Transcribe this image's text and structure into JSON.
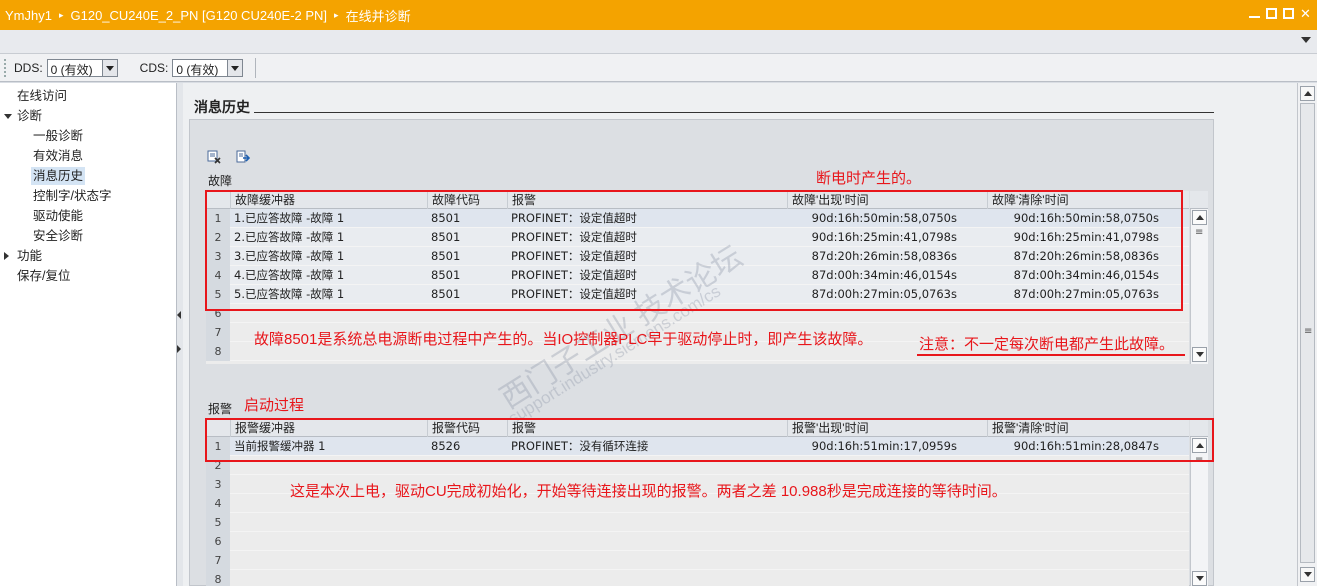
{
  "titlebar": {
    "crumbs": [
      "YmJhy1",
      "G120_CU240E_2_PN [G120 CU240E-2 PN]",
      "在线并诊断"
    ],
    "separator": "▸"
  },
  "toolbar": {
    "dds_label": "DDS:",
    "dds_value": "0 (有效)",
    "cds_label": "CDS:",
    "cds_value": "0 (有效)"
  },
  "nav": {
    "items": [
      {
        "label": "在线访问",
        "level": 0
      },
      {
        "label": "诊断",
        "level": 0,
        "expanded": true
      },
      {
        "label": "一般诊断",
        "level": 1
      },
      {
        "label": "有效消息",
        "level": 1
      },
      {
        "label": "消息历史",
        "level": 1,
        "selected": true
      },
      {
        "label": "控制字/状态字",
        "level": 1
      },
      {
        "label": "驱动使能",
        "level": 1
      },
      {
        "label": "安全诊断",
        "level": 1
      },
      {
        "label": "功能",
        "level": 0,
        "collapsed": true
      },
      {
        "label": "保存/复位",
        "level": 0
      }
    ]
  },
  "content": {
    "title": "消息历史",
    "faults": {
      "group_label": "故障",
      "columns": [
        "故障缓冲器",
        "故障代码",
        "报警",
        "故障'出现'时间",
        "故障'清除'时间"
      ],
      "row_numbers": [
        "1",
        "2",
        "3",
        "4",
        "5",
        "6",
        "7",
        "8"
      ],
      "rows": [
        [
          "1.已应答故障 -故障 1",
          "8501",
          "PROFINET：设定值超时",
          "90d:16h:50min:58,0750s",
          "90d:16h:50min:58,0750s"
        ],
        [
          "2.已应答故障 -故障 1",
          "8501",
          "PROFINET：设定值超时",
          "90d:16h:25min:41,0798s",
          "90d:16h:25min:41,0798s"
        ],
        [
          "3.已应答故障 -故障 1",
          "8501",
          "PROFINET：设定值超时",
          "87d:20h:26min:58,0836s",
          "87d:20h:26min:58,0836s"
        ],
        [
          "4.已应答故障 -故障 1",
          "8501",
          "PROFINET：设定值超时",
          "87d:00h:34min:46,0154s",
          "87d:00h:34min:46,0154s"
        ],
        [
          "5.已应答故障 -故障 1",
          "8501",
          "PROFINET：设定值超时",
          "87d:00h:27min:05,0763s",
          "87d:00h:27min:05,0763s"
        ]
      ]
    },
    "alarms": {
      "group_label": "报警",
      "columns": [
        "报警缓冲器",
        "报警代码",
        "报警",
        "报警'出现'时间",
        "报警'清除'时间"
      ],
      "row_numbers": [
        "1",
        "2",
        "3",
        "4",
        "5",
        "6",
        "7",
        "8"
      ],
      "rows": [
        [
          "当前报警缓冲器 1",
          "8526",
          "PROFINET：没有循环连接",
          "90d:16h:51min:17,0959s",
          "90d:16h:51min:28,0847s"
        ]
      ]
    }
  },
  "annotations": {
    "power_off": "断电时产生的。",
    "fault_explain": "故障8501是系统总电源断电过程中产生的。当IO控制器PLC早于驱动停止时，即产生该故障。",
    "note": "注意：不一定每次断电都产生此故障。",
    "startup": "启动过程",
    "alarm_explain": "这是本次上电，驱动CU完成初始化，开始等待连接出现的报警。两者之差 10.988秒是完成连接的等待时间。"
  },
  "watermark": {
    "line1": "西门子工业 技术论坛",
    "line2": "support.industry.siemens.com/cs"
  },
  "colors": {
    "titlebar": "#f4a300",
    "annotation_red": "#e8161b",
    "selected_nav": "#d4e4f4"
  }
}
